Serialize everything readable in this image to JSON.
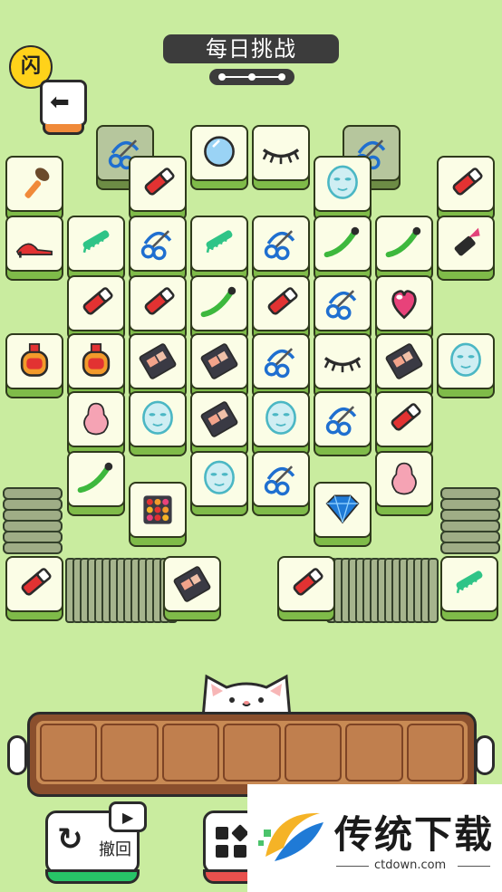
{
  "header": {
    "title": "每日挑战",
    "logo_glyph": "闪",
    "back_arrow": "⬅"
  },
  "colors": {
    "background": "#c9ec9f",
    "tile_face": "#fbfde6",
    "tile_side": "#7fbb49",
    "tray": "#c88a54",
    "undo_accent": "#27c467",
    "shuffle_accent": "#e8504d"
  },
  "board": {
    "tiles": [
      {
        "icon": "eyelash-curler-icon",
        "dim": true
      },
      {
        "icon": "mirror-icon",
        "dim": false
      },
      {
        "icon": "eyelashes-icon",
        "dim": false
      },
      {
        "icon": "eyelash-curler-icon",
        "dim": true
      },
      {
        "icon": "makeup-brush-icon",
        "dim": false
      },
      {
        "icon": "lipstick-red-icon",
        "dim": false
      },
      {
        "icon": "face-mask-icon",
        "dim": false
      },
      {
        "icon": "lipstick-red-icon",
        "dim": false
      },
      {
        "icon": "high-heels-icon",
        "dim": false
      },
      {
        "icon": "comb-icon",
        "dim": false
      },
      {
        "icon": "eyelash-curler-icon",
        "dim": false
      },
      {
        "icon": "comb-icon",
        "dim": false
      },
      {
        "icon": "eyelash-curler-icon",
        "dim": false
      },
      {
        "icon": "hair-straightener-icon",
        "dim": false
      },
      {
        "icon": "hair-straightener-icon",
        "dim": false
      },
      {
        "icon": "lipstick-icon",
        "dim": false
      },
      {
        "icon": "lipstick-red-icon",
        "dim": false
      },
      {
        "icon": "lipstick-red-icon",
        "dim": false
      },
      {
        "icon": "hair-straightener-icon",
        "dim": false
      },
      {
        "icon": "lipstick-red-icon",
        "dim": false
      },
      {
        "icon": "eyelash-curler-icon",
        "dim": false
      },
      {
        "icon": "compact-icon",
        "dim": false
      },
      {
        "icon": "perfume-icon",
        "dim": false
      },
      {
        "icon": "perfume-icon",
        "dim": false
      },
      {
        "icon": "eyeshadow-palette-icon",
        "dim": false
      },
      {
        "icon": "eyeshadow-palette-icon",
        "dim": false
      },
      {
        "icon": "eyelash-curler-icon",
        "dim": false
      },
      {
        "icon": "eyelashes-icon",
        "dim": false
      },
      {
        "icon": "eyeshadow-palette-icon",
        "dim": false
      },
      {
        "icon": "face-mask-icon",
        "dim": false
      },
      {
        "icon": "makeup-sponge-icon",
        "dim": false
      },
      {
        "icon": "face-mask-icon",
        "dim": false
      },
      {
        "icon": "eyeshadow-palette-icon",
        "dim": false
      },
      {
        "icon": "face-mask-icon",
        "dim": false
      },
      {
        "icon": "eyelash-curler-icon",
        "dim": false
      },
      {
        "icon": "lipstick-red-icon",
        "dim": false
      },
      {
        "icon": "hair-straightener-icon",
        "dim": false
      },
      {
        "icon": "face-mask-icon",
        "dim": false
      },
      {
        "icon": "eyelash-curler-icon",
        "dim": false
      },
      {
        "icon": "makeup-sponge-icon",
        "dim": false
      },
      {
        "icon": "eyeshadow-grid-icon",
        "dim": false
      },
      {
        "icon": "diamond-icon",
        "dim": false
      },
      {
        "icon": "lipstick-red-icon",
        "dim": false
      },
      {
        "icon": "eyeshadow-palette-icon",
        "dim": false
      },
      {
        "icon": "lipstick-red-icon",
        "dim": false
      },
      {
        "icon": "comb-icon",
        "dim": false
      }
    ]
  },
  "tray": {
    "slot_count": 7
  },
  "controls": {
    "undo_label": "撤回",
    "undo_icon": "refresh-icon",
    "video_icon": "play-icon",
    "shuffle_icon": "grid-icon"
  },
  "watermark": {
    "title": "传统下载",
    "url": "ctdown.com"
  }
}
